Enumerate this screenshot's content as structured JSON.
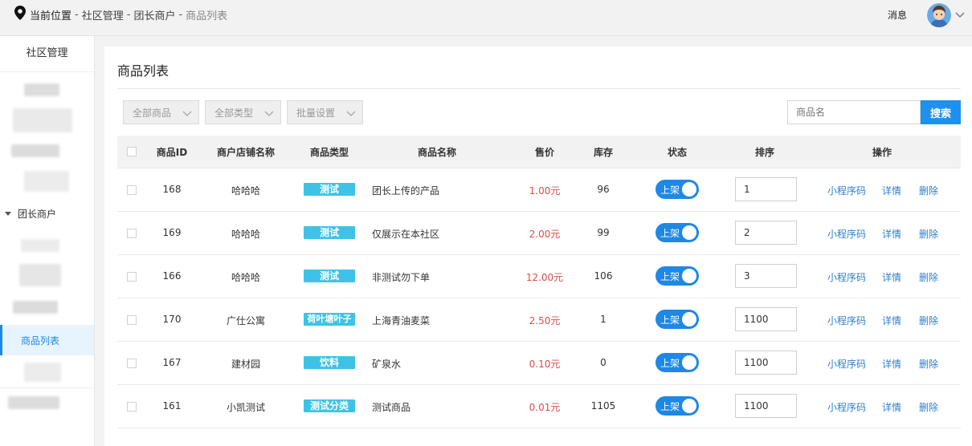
{
  "breadcrumb": {
    "current_label": "当前位置",
    "separator": "-",
    "items": [
      "社区管理",
      "团长商户",
      "商品列表"
    ]
  },
  "header": {
    "messages_label": "消息",
    "avatar_icon": "user-avatar-icon"
  },
  "sidebar": {
    "title": "社区管理",
    "group_label": "团长商户",
    "active_item": "商品列表"
  },
  "page": {
    "title": "商品列表"
  },
  "filters": {
    "all_products": "全部商品",
    "all_types": "全部类型",
    "bulk_settings": "批量设置"
  },
  "search": {
    "placeholder": "商品名",
    "button": "搜索"
  },
  "table": {
    "headers": {
      "id": "商品ID",
      "shop": "商户店铺名称",
      "type": "商品类型",
      "name": "商品名称",
      "price": "售价",
      "stock": "库存",
      "status": "状态",
      "sort": "排序",
      "actions": "操作"
    },
    "status_on_label": "上架",
    "action_labels": {
      "qrcode": "小程序码",
      "detail": "详情",
      "delete": "删除"
    },
    "rows": [
      {
        "id": "168",
        "shop": "哈哈哈",
        "type": "测试",
        "name": "团长上传的产品",
        "price": "1.00元",
        "stock": "96",
        "sort": "1"
      },
      {
        "id": "169",
        "shop": "哈哈哈",
        "type": "测试",
        "name": "仅展示在本社区",
        "price": "2.00元",
        "stock": "99",
        "sort": "2"
      },
      {
        "id": "166",
        "shop": "哈哈哈",
        "type": "测试",
        "name": "非测试勿下单",
        "price": "12.00元",
        "stock": "106",
        "sort": "3"
      },
      {
        "id": "170",
        "shop": "广仕公寓",
        "type": "荷叶塘叶子",
        "name": "上海青油麦菜",
        "price": "2.50元",
        "stock": "1",
        "sort": "1100"
      },
      {
        "id": "167",
        "shop": "建材园",
        "type": "饮料",
        "name": "矿泉水",
        "price": "0.10元",
        "stock": "0",
        "sort": "1100"
      },
      {
        "id": "161",
        "shop": "小凯测试",
        "type": "测试分类",
        "name": "测试商品",
        "price": "0.01元",
        "stock": "1105",
        "sort": "1100"
      }
    ]
  },
  "colors": {
    "accent": "#1e88e5",
    "price": "#e04a4a",
    "tag": "#3ec3e6"
  }
}
